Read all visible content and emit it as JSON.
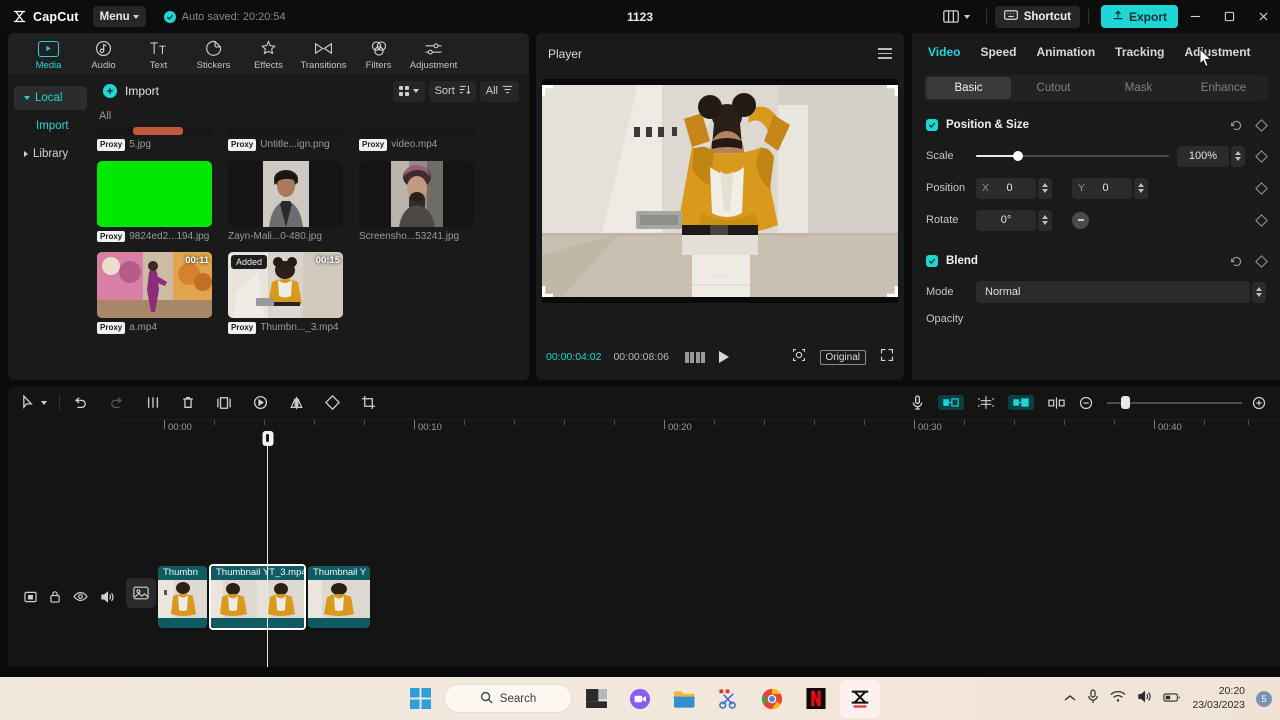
{
  "titlebar": {
    "app_name": "CapCut",
    "menu_label": "Menu",
    "autosave_text": "Auto saved: 20:20:54",
    "project_title": "1123",
    "shortcut_label": "Shortcut",
    "export_label": "Export"
  },
  "categories": [
    {
      "label": "Media",
      "icon": "media-icon",
      "active": true
    },
    {
      "label": "Audio",
      "icon": "audio-icon",
      "active": false
    },
    {
      "label": "Text",
      "icon": "text-icon",
      "active": false
    },
    {
      "label": "Stickers",
      "icon": "stickers-icon",
      "active": false
    },
    {
      "label": "Effects",
      "icon": "effects-icon",
      "active": false
    },
    {
      "label": "Transitions",
      "icon": "transitions-icon",
      "active": false
    },
    {
      "label": "Filters",
      "icon": "filters-icon",
      "active": false
    },
    {
      "label": "Adjustment",
      "icon": "adjustment-icon",
      "active": false
    }
  ],
  "media_sidebar": [
    {
      "label": "Local",
      "type": "group-open",
      "selected": true
    },
    {
      "label": "Import",
      "type": "child",
      "selected": false
    },
    {
      "label": "Library",
      "type": "group-closed",
      "selected": false
    }
  ],
  "media_panel": {
    "import_label": "Import",
    "sort_label": "Sort",
    "filter_all_label": "All",
    "section_label": "All",
    "proxy_tag": "Proxy",
    "added_tag": "Added",
    "items": [
      {
        "name": "5.jpg",
        "proxy": true,
        "kind": "strip",
        "duration": ""
      },
      {
        "name": "Untitle...ign.png",
        "proxy": true,
        "kind": "strip",
        "duration": ""
      },
      {
        "name": "video.mp4",
        "proxy": true,
        "kind": "strip",
        "duration": ""
      },
      {
        "name": "9824ed2...194.jpg",
        "proxy": true,
        "kind": "green",
        "duration": ""
      },
      {
        "name": "Zayn-Mali...0-480.jpg",
        "proxy": false,
        "kind": "portrait-a",
        "duration": ""
      },
      {
        "name": "Screensho...53241.jpg",
        "proxy": false,
        "kind": "portrait-b",
        "duration": ""
      },
      {
        "name": "a.mp4",
        "proxy": true,
        "kind": "dance",
        "duration": "00:11"
      },
      {
        "name": "Thumbn..._3.mp4",
        "proxy": true,
        "kind": "model",
        "duration": "00:15",
        "added": true
      }
    ]
  },
  "player": {
    "title": "Player",
    "current_time": "00:00:04:02",
    "total_time": "00:00:08:06",
    "scale_label": "Original"
  },
  "right_panel": {
    "tabs": [
      {
        "label": "Video",
        "active": true
      },
      {
        "label": "Speed",
        "active": false
      },
      {
        "label": "Animation",
        "active": false
      },
      {
        "label": "Tracking",
        "active": false
      },
      {
        "label": "Adjustment",
        "active": false
      }
    ],
    "subtabs": [
      {
        "label": "Basic",
        "active": true
      },
      {
        "label": "Cutout",
        "active": false
      },
      {
        "label": "Mask",
        "active": false
      },
      {
        "label": "Enhance",
        "active": false
      }
    ],
    "position_size": {
      "title": "Position & Size",
      "scale_label": "Scale",
      "scale_value": "100%",
      "scale_percent": 22,
      "position_label": "Position",
      "pos_x_axis": "X",
      "pos_x_value": "0",
      "pos_y_axis": "Y",
      "pos_y_value": "0",
      "rotate_label": "Rotate",
      "rotate_value": "0°"
    },
    "blend": {
      "title": "Blend",
      "mode_label": "Mode",
      "mode_value": "Normal",
      "opacity_label": "Opacity"
    }
  },
  "timeline": {
    "ruler_labels": [
      "00:00",
      "00:10",
      "00:20",
      "00:30",
      "00:40"
    ],
    "clips": [
      {
        "title": "Thumbn",
        "selected": false
      },
      {
        "title": "Thumbnail YT_3.mp4",
        "selected": true
      },
      {
        "title": "Thumbnail Y",
        "selected": false
      }
    ]
  },
  "taskbar": {
    "search_placeholder": "Search",
    "time": "20:20",
    "date": "23/03/2023",
    "notification_count": "5",
    "apps": [
      "start-icon",
      "search-pill",
      "taskview-icon",
      "meet-icon",
      "explorer-icon",
      "snip-icon",
      "chrome-icon",
      "netflix-icon",
      "capcut-icon"
    ]
  },
  "colors": {
    "accent": "#1fd6d6",
    "panel": "#1a1a1a",
    "clip": "#0f5b61"
  }
}
